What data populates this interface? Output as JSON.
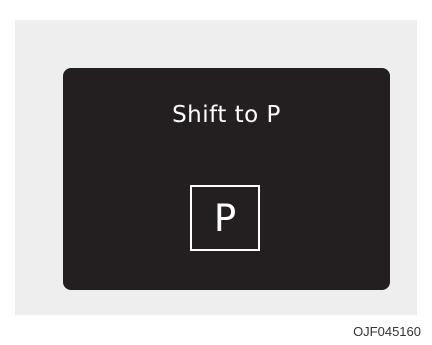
{
  "display": {
    "message": "Shift to P",
    "gear_indicator": "P",
    "background_color": "#231f20",
    "text_color": "#ffffff"
  },
  "figure": {
    "code": "OJF045160"
  }
}
